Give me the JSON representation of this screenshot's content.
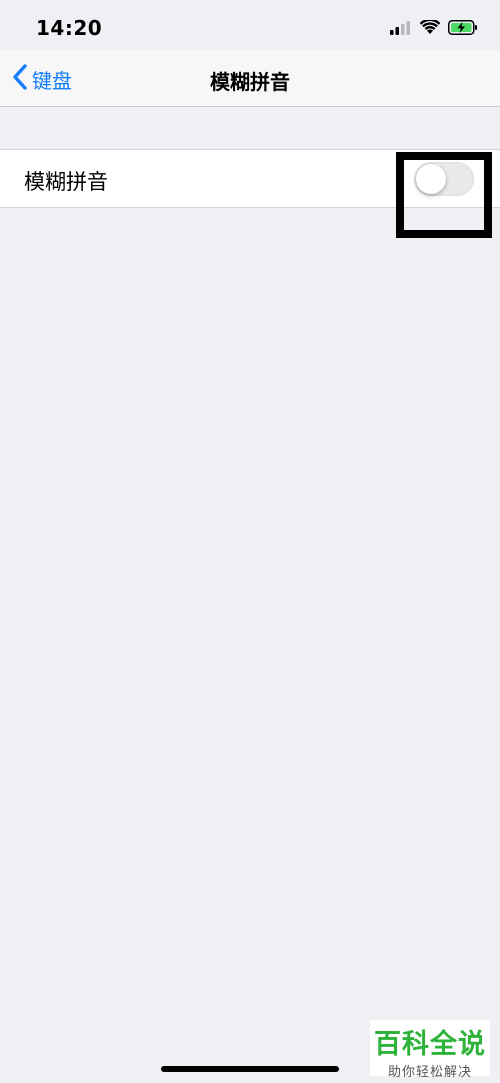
{
  "status_bar": {
    "time": "14:20",
    "icons": [
      "cellular-signal-icon",
      "wifi-icon",
      "battery-charging-icon"
    ]
  },
  "nav": {
    "back_label": "键盘",
    "title": "模糊拼音"
  },
  "setting": {
    "label": "模糊拼音",
    "toggle_on": false
  },
  "watermark": {
    "title": "百科全说",
    "subtitle": "助你轻松解决"
  },
  "colors": {
    "background": "#EFEFF4",
    "accent": "#157EFB",
    "battery": "#4CD964",
    "watermark_green": "#2DB33A",
    "annotation_box": "#000000"
  }
}
